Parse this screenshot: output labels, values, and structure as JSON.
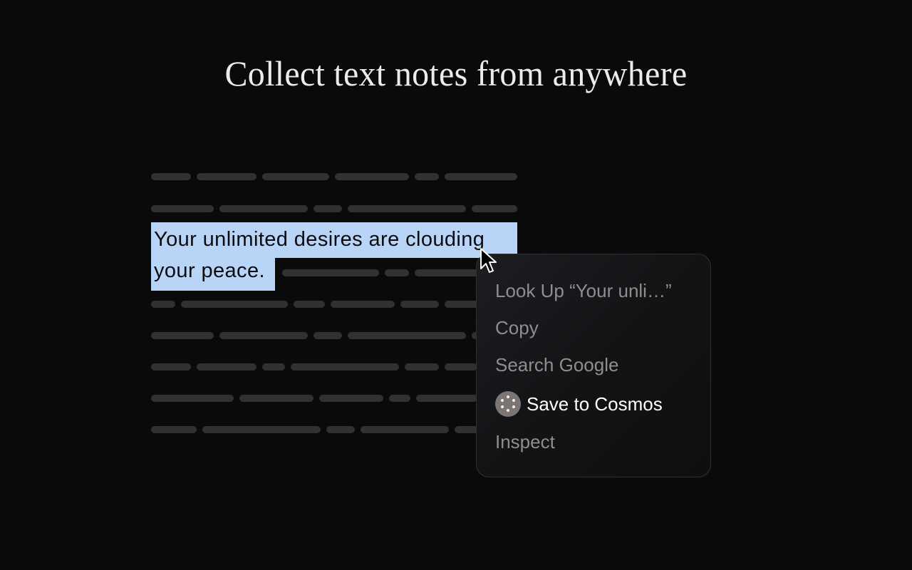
{
  "headline": "Collect text notes from anywhere",
  "selected_text": {
    "line1": "Your unlimited desires are clouding",
    "line2": "your peace."
  },
  "context_menu": {
    "items": [
      {
        "label": "Look Up “Your unli…”",
        "icon": null,
        "highlighted": false
      },
      {
        "label": "Copy",
        "icon": null,
        "highlighted": false
      },
      {
        "label": "Search Google",
        "icon": null,
        "highlighted": false
      },
      {
        "label": "Save to Cosmos",
        "icon": "cosmos-dots-icon",
        "highlighted": true
      },
      {
        "label": "Inspect",
        "icon": null,
        "highlighted": false
      }
    ]
  },
  "colors": {
    "background": "#0a0a0a",
    "placeholder_bar": "#313133",
    "selection": "#b8d5f7",
    "menu_text_muted": "#8e8e91",
    "menu_text_primary": "#ffffff",
    "cosmos_icon": "#7b7574"
  }
}
